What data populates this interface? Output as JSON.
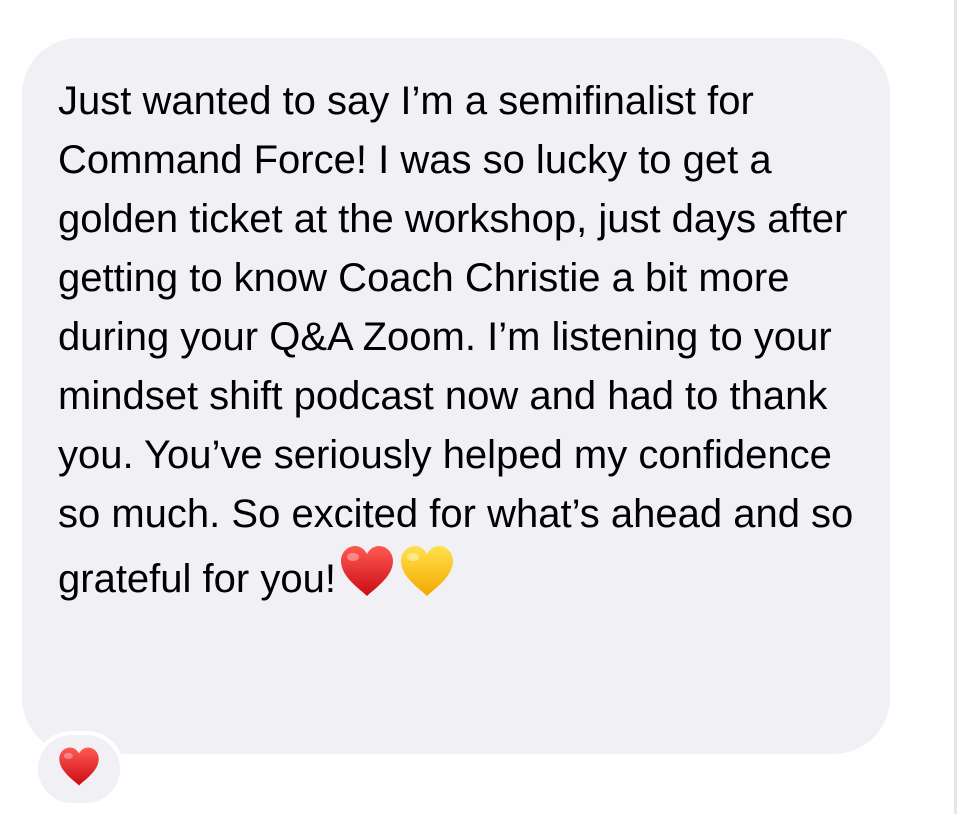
{
  "message": {
    "text": "Just wanted to say I’m a semifinalist for Command Force! I was so lucky to get a golden ticket at the workshop, just days after getting to know Coach Christie a bit more during your Q&A Zoom. I’m listening to your mindset shift podcast now and had to thank you. You’ve seriously helped my confidence so much. So excited for what’s ahead and so grateful for you!",
    "emojis": [
      "red-heart",
      "yellow-heart"
    ]
  },
  "reaction": {
    "emoji": "red-heart"
  },
  "colors": {
    "bubble_background": "#f1f1f5",
    "text": "#000000",
    "red_heart": "#e0161e",
    "yellow_heart": "#ffc917"
  }
}
